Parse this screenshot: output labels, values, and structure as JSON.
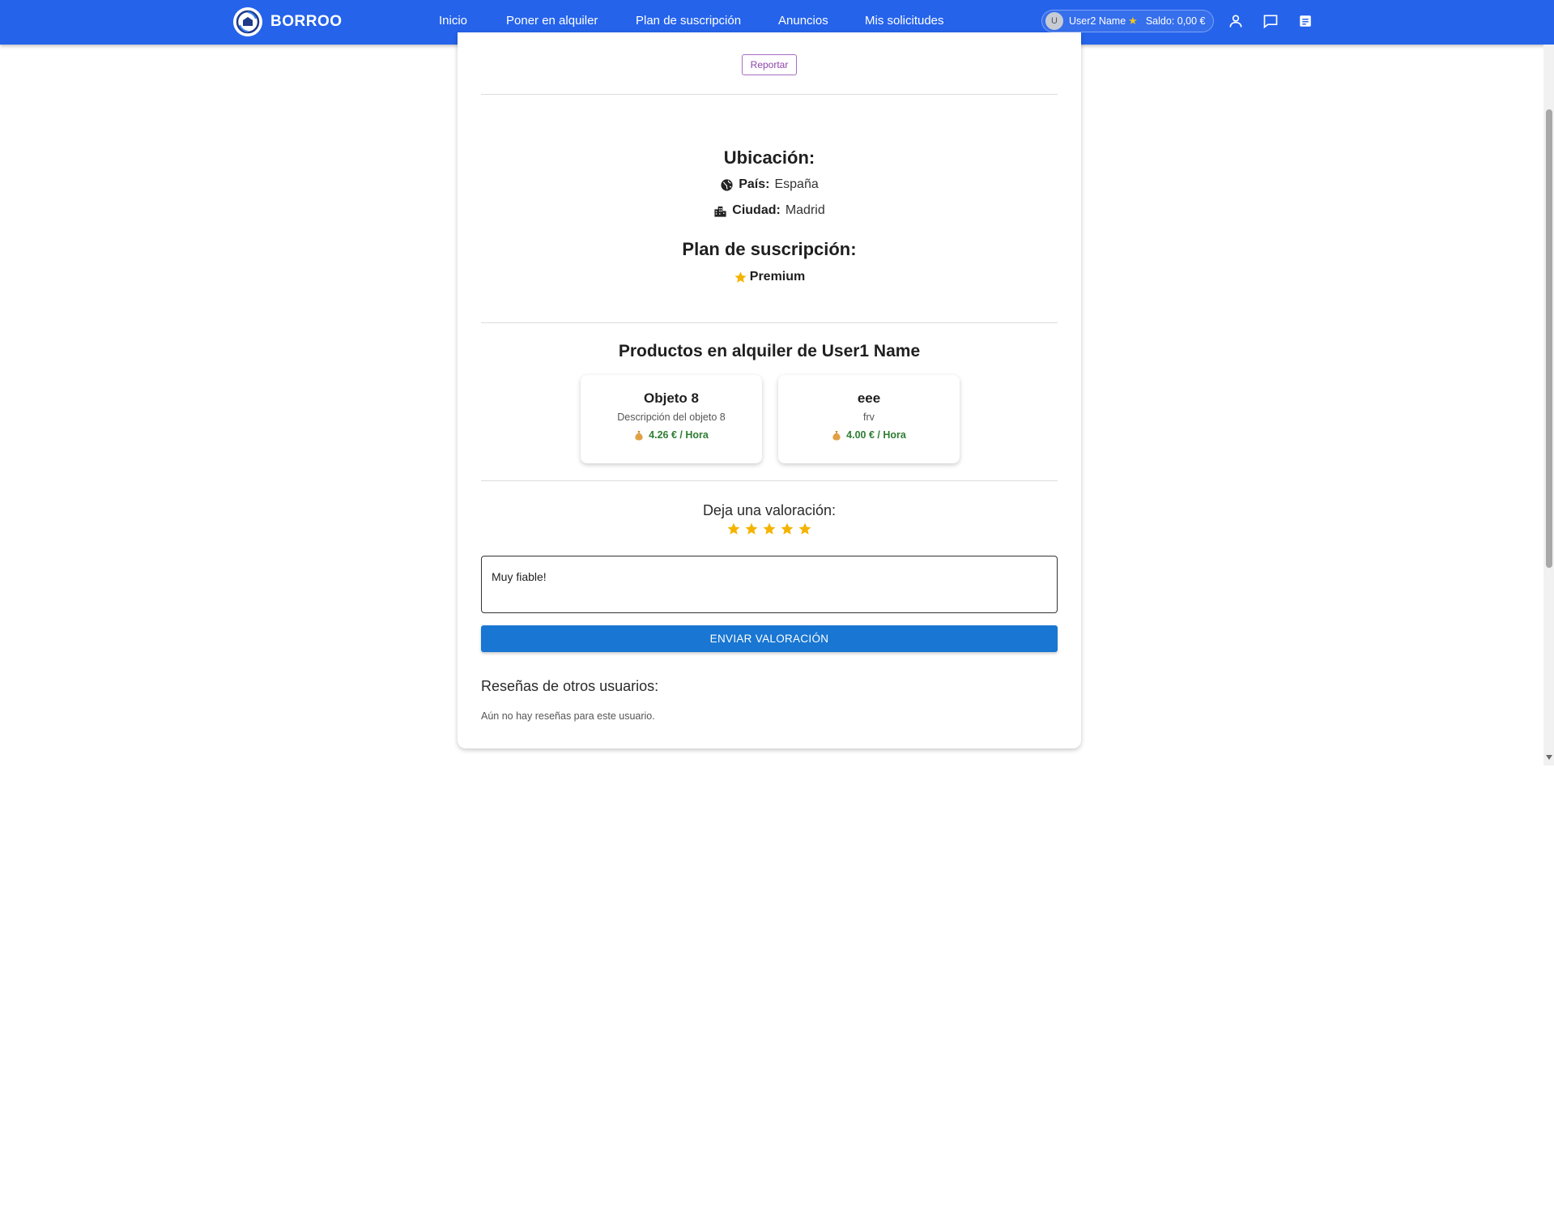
{
  "nav": {
    "brand": "BORROO",
    "links": [
      "Inicio",
      "Poner en alquiler",
      "Plan de suscripción",
      "Anuncios",
      "Mis solicitudes"
    ],
    "user": {
      "avatar_letter": "U",
      "name": "User2 Name",
      "star": "★",
      "balance": "Saldo: 0,00 €"
    },
    "icons": [
      "user-icon",
      "chat-icon",
      "document-icon"
    ]
  },
  "profile": {
    "report_label": "Reportar",
    "location_title": "Ubicación:",
    "country_label": "País:",
    "country_value": "España",
    "city_label": "Ciudad:",
    "city_value": "Madrid",
    "plan_title": "Plan de suscripción:",
    "plan_value": "Premium"
  },
  "products": {
    "title": "Productos en alquiler de User1 Name",
    "items": [
      {
        "name": "Objeto 8",
        "description": "Descripción del objeto 8",
        "price": "4.26 € / Hora"
      },
      {
        "name": "eee",
        "description": "frv",
        "price": "4.00 € / Hora"
      }
    ]
  },
  "rating": {
    "label": "Deja una valoración:",
    "stars": 5,
    "max_stars": 5,
    "review_text": "Muy fiable!",
    "submit_label": "ENVIAR VALORACIÓN"
  },
  "reviews": {
    "title": "Reseñas de otros usuarios:",
    "empty_text": "Aún no hay reseñas para este usuario."
  },
  "colors": {
    "nav_bg": "#2563eb",
    "button_primary": "#1976d2",
    "star": "#f5b301",
    "price": "#2e7d32",
    "report": "#8e44ad"
  }
}
